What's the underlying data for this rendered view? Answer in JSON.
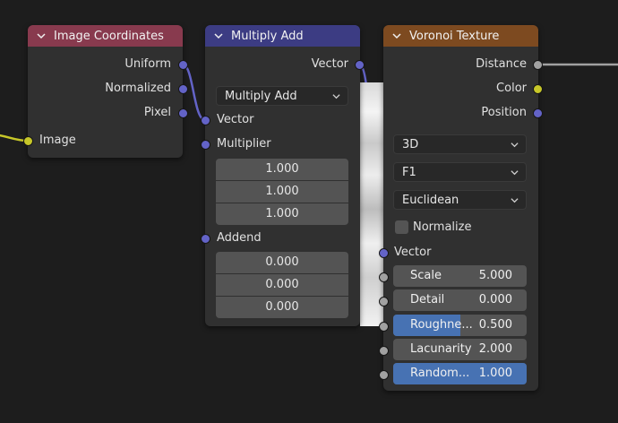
{
  "colors": {
    "background": "#1d1d1d",
    "node_body": "#303030",
    "header_input": "#883a4e",
    "header_converter": "#3c3c83",
    "header_texture": "#7d4a20",
    "socket_vector": "#6363c7",
    "socket_color": "#c7c729",
    "socket_float": "#a1a1a1",
    "slider_fill": "#4772b3"
  },
  "image_coordinates": {
    "title": "Image Coordinates",
    "outputs": [
      "Uniform",
      "Normalized",
      "Pixel"
    ],
    "input_label": "Image"
  },
  "multiply_add": {
    "title": "Multiply Add",
    "output_label": "Vector",
    "operation": "Multiply Add",
    "vector_label": "Vector",
    "multiplier_label": "Multiplier",
    "multiplier_values": [
      "1.000",
      "1.000",
      "1.000"
    ],
    "addend_label": "Addend",
    "addend_values": [
      "0.000",
      "0.000",
      "0.000"
    ]
  },
  "voronoi": {
    "title": "Voronoi Texture",
    "outputs": [
      "Distance",
      "Color",
      "Position"
    ],
    "dimensions": "3D",
    "feature": "F1",
    "metric": "Euclidean",
    "normalize_label": "Normalize",
    "vector_label": "Vector",
    "params": [
      {
        "label": "Scale",
        "value": "5.000",
        "fill": 0
      },
      {
        "label": "Detail",
        "value": "0.000",
        "fill": 0
      },
      {
        "label": "Roughne...",
        "value": "0.500",
        "fill": 0.5
      },
      {
        "label": "Lacunarity",
        "value": "2.000",
        "fill": 0
      },
      {
        "label": "Random...",
        "value": "1.000",
        "fill": 1.0
      }
    ]
  },
  "icons": [
    "chevron-down-icon",
    "dropdown-chevron-icon"
  ]
}
